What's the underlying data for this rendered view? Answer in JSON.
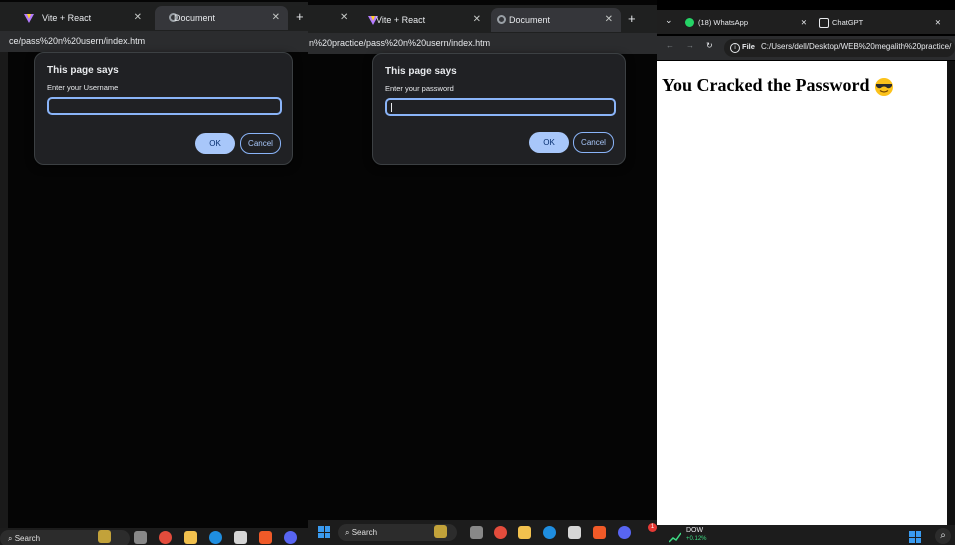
{
  "window1": {
    "tabs": [
      {
        "label": "Vite + React",
        "close": "✕"
      },
      {
        "label": "Document",
        "close": "✕"
      }
    ],
    "new_tab": "+",
    "url": "ce/pass%20n%20usern/index.htm",
    "dialog": {
      "title": "This page says",
      "message": "Enter your Username",
      "value": "",
      "ok": "OK",
      "cancel": "Cancel"
    },
    "taskbar": {
      "search": "Search"
    }
  },
  "window2": {
    "tabs": [
      {
        "label": "Vite + React",
        "close": "✕"
      },
      {
        "label": "Document",
        "close": "✕"
      }
    ],
    "leftover_close": "✕",
    "new_tab": "+",
    "url": "n%20practice/pass%20n%20usern/index.htm",
    "dialog": {
      "title": "This page says",
      "message": "Enter your password",
      "value": "",
      "ok": "OK",
      "cancel": "Cancel"
    },
    "taskbar": {
      "search": "Search",
      "badge": "1"
    }
  },
  "window3": {
    "tabs": [
      {
        "label": "(18) WhatsApp",
        "close": "✕"
      },
      {
        "label": "ChatGPT",
        "close": "✕"
      }
    ],
    "file_label": "File",
    "url": "C:/Users/dell/Desktop/WEB%20megalith%20practice/",
    "headline": "You Cracked the Password",
    "ticker": {
      "name": "DOW",
      "change": "+0.12%"
    }
  },
  "colors": {
    "accent": "#a8c7fa",
    "input_border": "#8ab4f8",
    "dialog_bg": "#202124"
  }
}
